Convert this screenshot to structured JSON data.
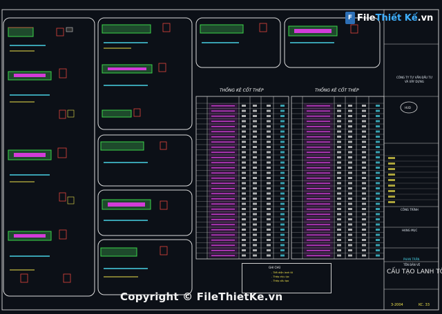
{
  "logo": {
    "badge": "F",
    "name_left": "File",
    "name_right": "Thiết Kế",
    "suffix": ".vn"
  },
  "watermark": "Copyright © FileThietKe.vn",
  "tables": {
    "left_title": "THỐNG KÊ CỐT THÉP",
    "right_title": "THỐNG KÊ CỐT THÉP"
  },
  "title_block": {
    "project_title": "CẤU TẠO LANH TÔ",
    "sheet_code": "KC. 33",
    "number": "3-2004",
    "approver_name": "PHAN TRẦN",
    "company_line_1": "CÔNG TY TƯ VẤN ĐẦU TƯ",
    "company_line_2": "VÀ XÂY DỰNG",
    "section_label": "CÔNG TRÌNH",
    "item_label": "HẠNG MỤC",
    "drawing_label": "TÊN BẢN VẼ"
  },
  "legend": {
    "title": "GHI CHÚ",
    "lines": [
      "- Tiết diện lanh tô",
      "- Thép chịu lực",
      "- Thép cấu tạo"
    ]
  },
  "colors": {
    "background": "#0c1017",
    "line_white": "#dcdcdc",
    "cyan": "#48d3e6",
    "yellow": "#f1e44b",
    "magenta": "#d23cd8",
    "green": "#3bd64a",
    "red": "#e5453d"
  }
}
